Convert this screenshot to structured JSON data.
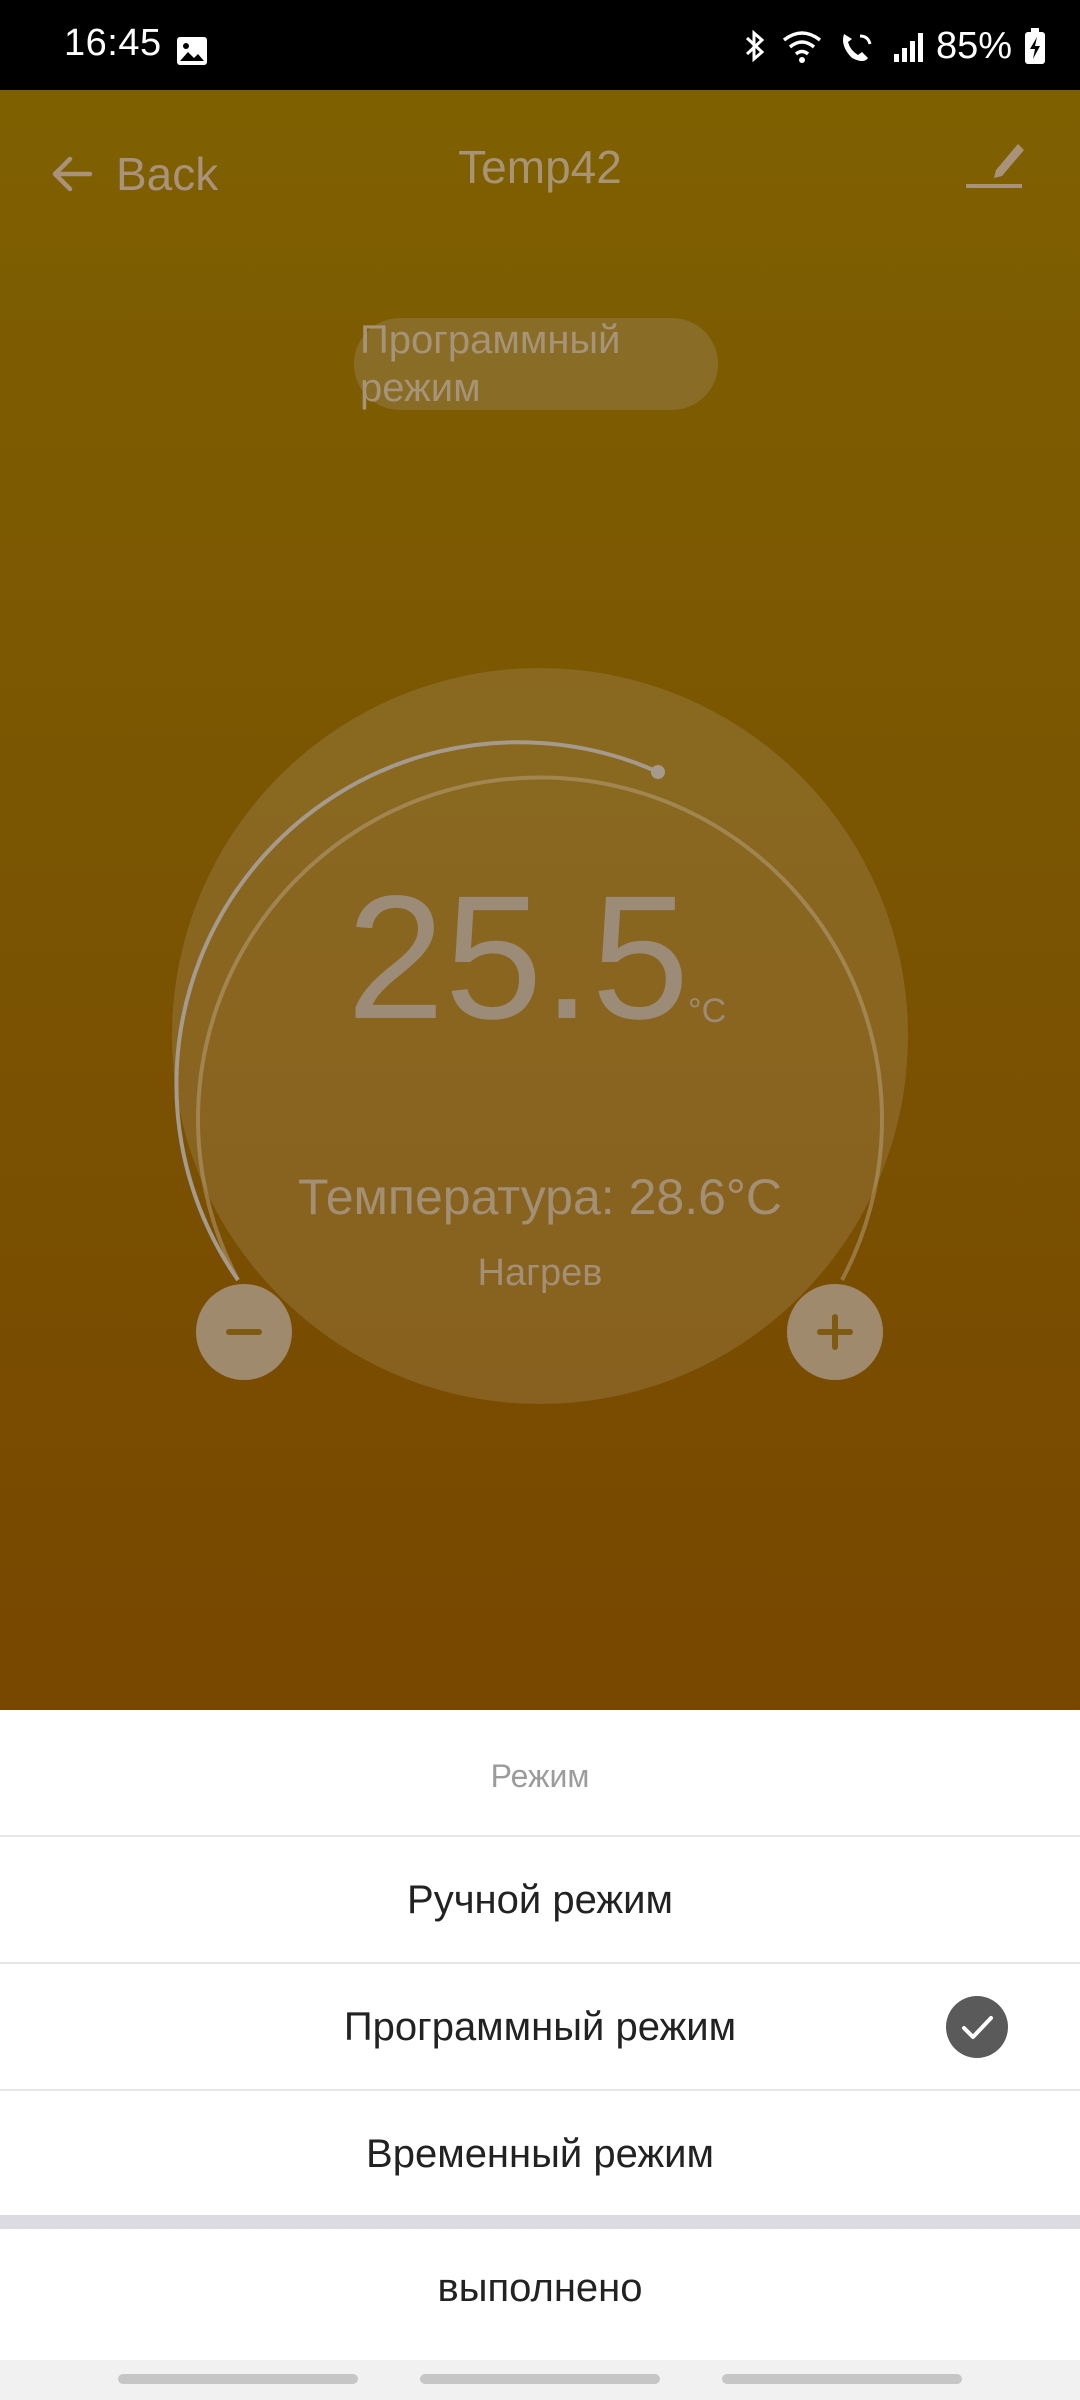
{
  "status_bar": {
    "time": "16:45",
    "battery": "85%",
    "icons": [
      "photo-icon",
      "bluetooth-icon",
      "wifi-icon",
      "wifi-call-icon",
      "signal-icon",
      "battery-charging-icon"
    ]
  },
  "header": {
    "back_label": "Back",
    "title": "Temp42",
    "edit_icon": "edit-pencil-icon"
  },
  "mode_pill": {
    "label": "Программный режим"
  },
  "dial": {
    "set_temperature": "25.5",
    "unit": "°C",
    "current_temperature_text": "Температура: 28.6°C",
    "state": "Нагрев",
    "minus_icon": "minus-icon",
    "plus_icon": "plus-icon"
  },
  "sheet": {
    "title": "Режим",
    "options": [
      {
        "label": "Ручной режим",
        "selected": false
      },
      {
        "label": "Программный режим",
        "selected": true
      },
      {
        "label": "Временный режим",
        "selected": false
      }
    ],
    "done_label": "выполнено"
  },
  "colors": {
    "background_top": "#7e6001",
    "background_bottom": "#784700",
    "sheet": "#ffffff",
    "check": "#5a5a5a"
  }
}
